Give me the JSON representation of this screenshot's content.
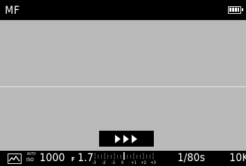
{
  "top_bar": {
    "focus_mode": "MF",
    "battery_icon": "battery-full-icon"
  },
  "overlay": {
    "play_icon": "triple-play-icon"
  },
  "bottom_bar": {
    "scene_icon": "landscape-scene-icon",
    "iso_auto": "AUTO",
    "iso_label": "ISO",
    "iso_value": "1000",
    "aperture_prefix": "F",
    "aperture_value": "1.7",
    "ev_scale_labels": [
      "-3",
      "-2",
      "-1",
      "0",
      "+1",
      "+2",
      "+3"
    ],
    "ev_value": 0,
    "shutter": "1/80s",
    "shots_remaining": "10K"
  }
}
